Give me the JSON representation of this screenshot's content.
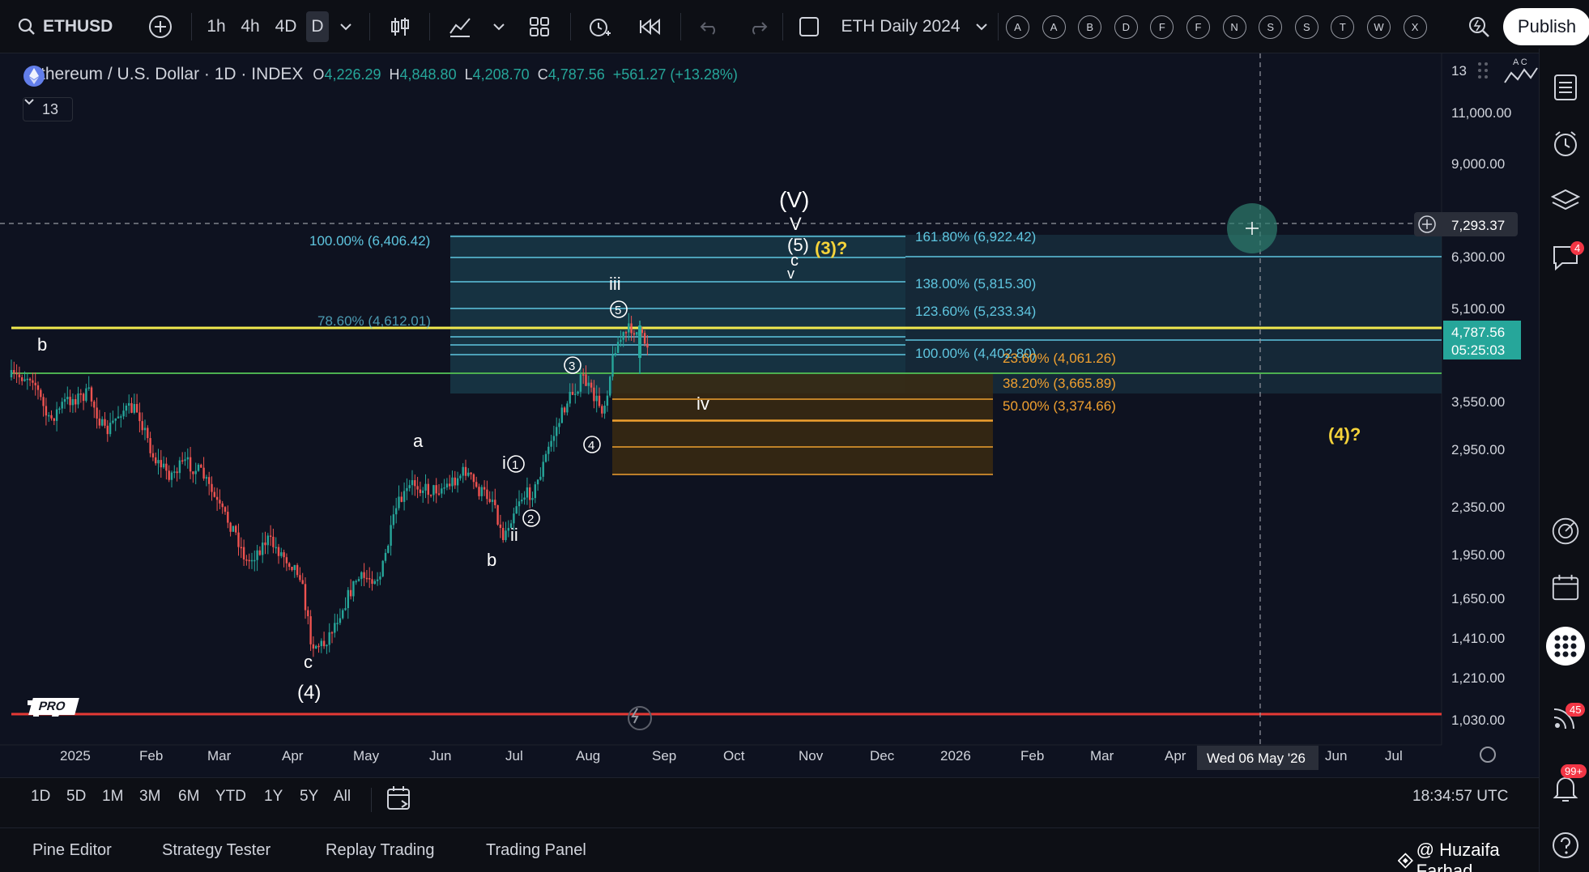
{
  "toolbar": {
    "symbol": "ETHUSD",
    "intervals": [
      "1h",
      "4h",
      "4D",
      "D"
    ],
    "layout_name": "ETH Daily 2024",
    "alpha_buttons": [
      "A",
      "A",
      "B",
      "D",
      "F",
      "F",
      "N",
      "S",
      "S",
      "T",
      "W",
      "X"
    ],
    "publish_label": "Publish"
  },
  "legend": {
    "title": "Ethereum / U.S. Dollar · 1D · INDEX",
    "o_label": "O",
    "o_value": "4,226.29",
    "h_label": "H",
    "h_value": "4,848.80",
    "l_label": "L",
    "l_value": "4,208.70",
    "c_label": "C",
    "c_value": "4,787.56",
    "change": "+561.27 (+13.28%)",
    "indicator_count": "13"
  },
  "price_axis": {
    "labels": [
      "13",
      "11,000.00",
      "9,000.00",
      "6,300.00",
      "5,100.00",
      "3,550.00",
      "2,950.00",
      "2,350.00",
      "1,950.00",
      "1,650.00",
      "1,410.00",
      "1,210.00",
      "1,030.00"
    ],
    "crosshair_price": "7,293.37",
    "last_price": "4,787.56",
    "countdown": "05:25:03"
  },
  "time_axis": {
    "labels": [
      "2025",
      "Feb",
      "Mar",
      "Apr",
      "May",
      "Jun",
      "Jul",
      "Aug",
      "Sep",
      "Oct",
      "Nov",
      "Dec",
      "2026",
      "Feb",
      "Mar",
      "Apr",
      "Jun",
      "Jul"
    ],
    "crosshair_date": "Wed 06 May '26"
  },
  "fib_blue": {
    "left": [
      {
        "label": "100.00% (6,406.42)"
      },
      {
        "label": "78.60% (4,612.01)"
      }
    ],
    "right": [
      {
        "label": "161.80% (6,922.42)"
      },
      {
        "label": "138.00% (5,815.30)"
      },
      {
        "label": "123.60% (5,233.34)"
      },
      {
        "label": "100.00% (4,402.80)"
      }
    ]
  },
  "fib_orange": [
    {
      "label": "23.60% (4,061.26)"
    },
    {
      "label": "38.20% (3,665.89)"
    },
    {
      "label": "50.00% (3,374.66)"
    }
  ],
  "wave_labels": {
    "V_big": "(V)",
    "V_small": "V",
    "five_paren": "(5)",
    "three_q": "(3)?",
    "c_top": "c",
    "v_top": "v",
    "iii": "iii",
    "circ5": "5",
    "circ3": "3",
    "circ4": "4",
    "iv": "iv",
    "four_q": "(4)?",
    "a": "a",
    "i": "i",
    "circ1": "1",
    "circ2": "2",
    "ii": "ii",
    "b_mid": "b",
    "b_left": "b",
    "c_bottom": "c",
    "four_paren": "(4)"
  },
  "watermark": "PRO",
  "range_bar": {
    "items": [
      "1D",
      "5D",
      "1M",
      "3M",
      "6M",
      "YTD",
      "1Y",
      "5Y",
      "All"
    ],
    "clock": "18:34:57 UTC"
  },
  "bottom_panel": {
    "tabs": [
      "Pine Editor",
      "Strategy Tester",
      "Replay Trading",
      "Trading Panel"
    ],
    "credit": "@ Huzaifa Farhad"
  },
  "badges": {
    "chat": "4",
    "signals": "45",
    "notifications": "99+"
  },
  "colors": {
    "bull": "#26a69a",
    "bear": "#ef5350",
    "fib_blue": "#5fc6e0",
    "fib_orange": "#f0a030",
    "yellow_line": "#f2e94e",
    "green_line": "#4caf50",
    "red_line": "#e53935",
    "label_yellow": "#f5d33a"
  }
}
